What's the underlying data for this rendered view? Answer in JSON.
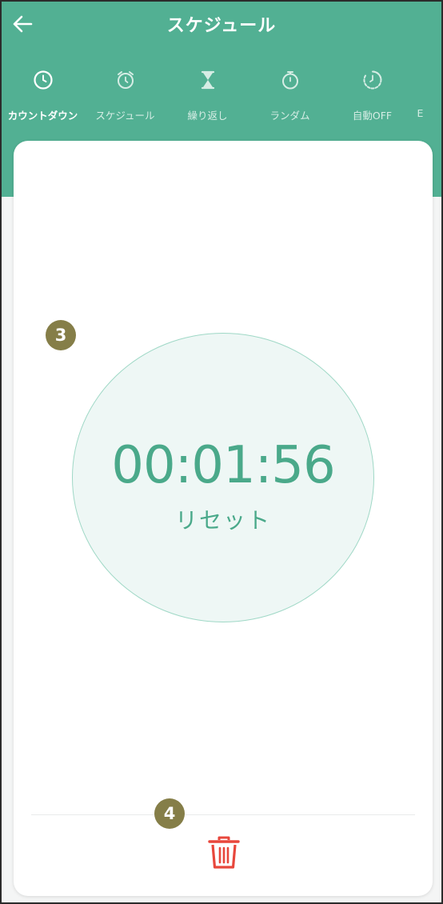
{
  "header": {
    "title": "スケジュール",
    "back_icon": "arrow-left-icon",
    "background": "#52b093"
  },
  "tabs": [
    {
      "label": "カウントダウン",
      "icon": "clock-icon",
      "active": true
    },
    {
      "label": "スケジュール",
      "icon": "alarm-clock-icon",
      "active": false
    },
    {
      "label": "繰り返し",
      "icon": "hourglass-icon",
      "active": false
    },
    {
      "label": "ランダム",
      "icon": "stopwatch-icon",
      "active": false
    },
    {
      "label": "自動OFF",
      "icon": "timer-off-icon",
      "active": false
    },
    {
      "label": "E",
      "icon": "",
      "active": false
    }
  ],
  "timer": {
    "time": "00:01:56",
    "reset_label": "リセット",
    "accent": "#4aa98a",
    "circle_fill": "#eef7f5"
  },
  "markers": {
    "m1": "3",
    "m2": "4"
  },
  "footer": {
    "delete_icon": "trash-icon",
    "delete_color": "#e8473c"
  }
}
